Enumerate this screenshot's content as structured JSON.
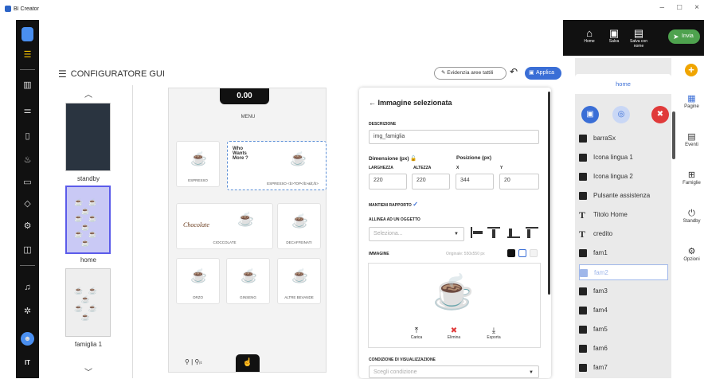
{
  "app": {
    "title": "BI Creator",
    "window_controls": [
      "–",
      "□",
      "×"
    ]
  },
  "rail": {
    "logo_icon": "bi-logo-icon",
    "lang": "IT"
  },
  "topbar": {
    "buttons": [
      {
        "label": "Home",
        "icon": "home-icon",
        "glyph": "⌂"
      },
      {
        "label": "Salva",
        "icon": "save-icon",
        "glyph": "▣"
      },
      {
        "label": "Salva con nome",
        "icon": "save-as-icon",
        "glyph": "▤"
      }
    ],
    "send": {
      "label": "Invia",
      "glyph": "➤"
    }
  },
  "configurator": {
    "title": "CONFIGURATORE GUI",
    "highlight_label": "Evidenzia aree tattili",
    "apply_label": "Applica"
  },
  "pages_list": [
    "standby",
    "home",
    "famiglia 1"
  ],
  "canvas": {
    "price": "0.00",
    "menu_label": "MENU",
    "tiles": [
      {
        "label": "ESPRESSO"
      },
      {
        "label": "ESPRESSO <b>TOP</b>&lt;/b>",
        "heading": "Who Wants More ?"
      },
      {
        "label": "CIOCCOLATE",
        "script": "Chocolate"
      },
      {
        "label": "DECAFFEINATI"
      },
      {
        "label": "ORZO"
      },
      {
        "label": "GINSENG"
      },
      {
        "label": "ALTRE BEVANDE"
      }
    ],
    "footer": "⚲ | ⚲ᵢₜ"
  },
  "panel": {
    "header": "Immagine selezionata",
    "description_label": "DESCRIZIONE",
    "description_value": "img_famiglia",
    "dimension_label": "Dimensione (px)",
    "position_label": "Posizione (px)",
    "width_label": "LARGHEZZA",
    "height_label": "ALTEZZA",
    "x_label": "X",
    "y_label": "Y",
    "width_value": "220",
    "height_value": "220",
    "x_value": "344",
    "y_value": "20",
    "keep_ratio_label": "MANTIENI RAPPORTO",
    "align_label": "ALLINEA AD UN OGGETTO",
    "align_placeholder": "Seleziona...",
    "image_label": "IMMAGINE",
    "original_label": "Originale: 550x550 px",
    "actions": [
      {
        "label": "Carica",
        "glyph": "⤒",
        "color": "#222222"
      },
      {
        "label": "Elimina",
        "glyph": "✖",
        "color": "#e03a3a"
      },
      {
        "label": "Esporta",
        "glyph": "⤓",
        "color": "#222222"
      }
    ],
    "condition_label": "CONDIZIONE DI VISUALIZZAZIONE",
    "condition_placeholder": "Scegli condizione"
  },
  "layers": {
    "tab": "home",
    "items": [
      {
        "label": "barraSx",
        "kind": "image"
      },
      {
        "label": "Icona lingua 1",
        "kind": "shape"
      },
      {
        "label": "Icona lingua 2",
        "kind": "shape"
      },
      {
        "label": "Pulsante assistenza",
        "kind": "shape"
      },
      {
        "label": "Titolo Home",
        "kind": "text"
      },
      {
        "label": "credito",
        "kind": "text"
      },
      {
        "label": "fam1",
        "kind": "image"
      },
      {
        "label": "fam2",
        "kind": "image"
      },
      {
        "label": "fam3",
        "kind": "image"
      },
      {
        "label": "fam4",
        "kind": "image"
      },
      {
        "label": "fam5",
        "kind": "image"
      },
      {
        "label": "fam6",
        "kind": "image"
      },
      {
        "label": "fam7",
        "kind": "image"
      }
    ]
  },
  "right_tabs": [
    {
      "label": "Pagine",
      "glyph": "▦"
    },
    {
      "label": "Eventi",
      "glyph": "▤"
    },
    {
      "label": "Famiglie",
      "glyph": "⊞"
    },
    {
      "label": "Standby",
      "glyph": "⏻"
    },
    {
      "label": "Opzioni",
      "glyph": "⚙"
    }
  ],
  "colors": {
    "accent": "#3a6ed6",
    "send": "#4ea24e",
    "danger": "#e03a3a",
    "plus": "#f0a500"
  }
}
